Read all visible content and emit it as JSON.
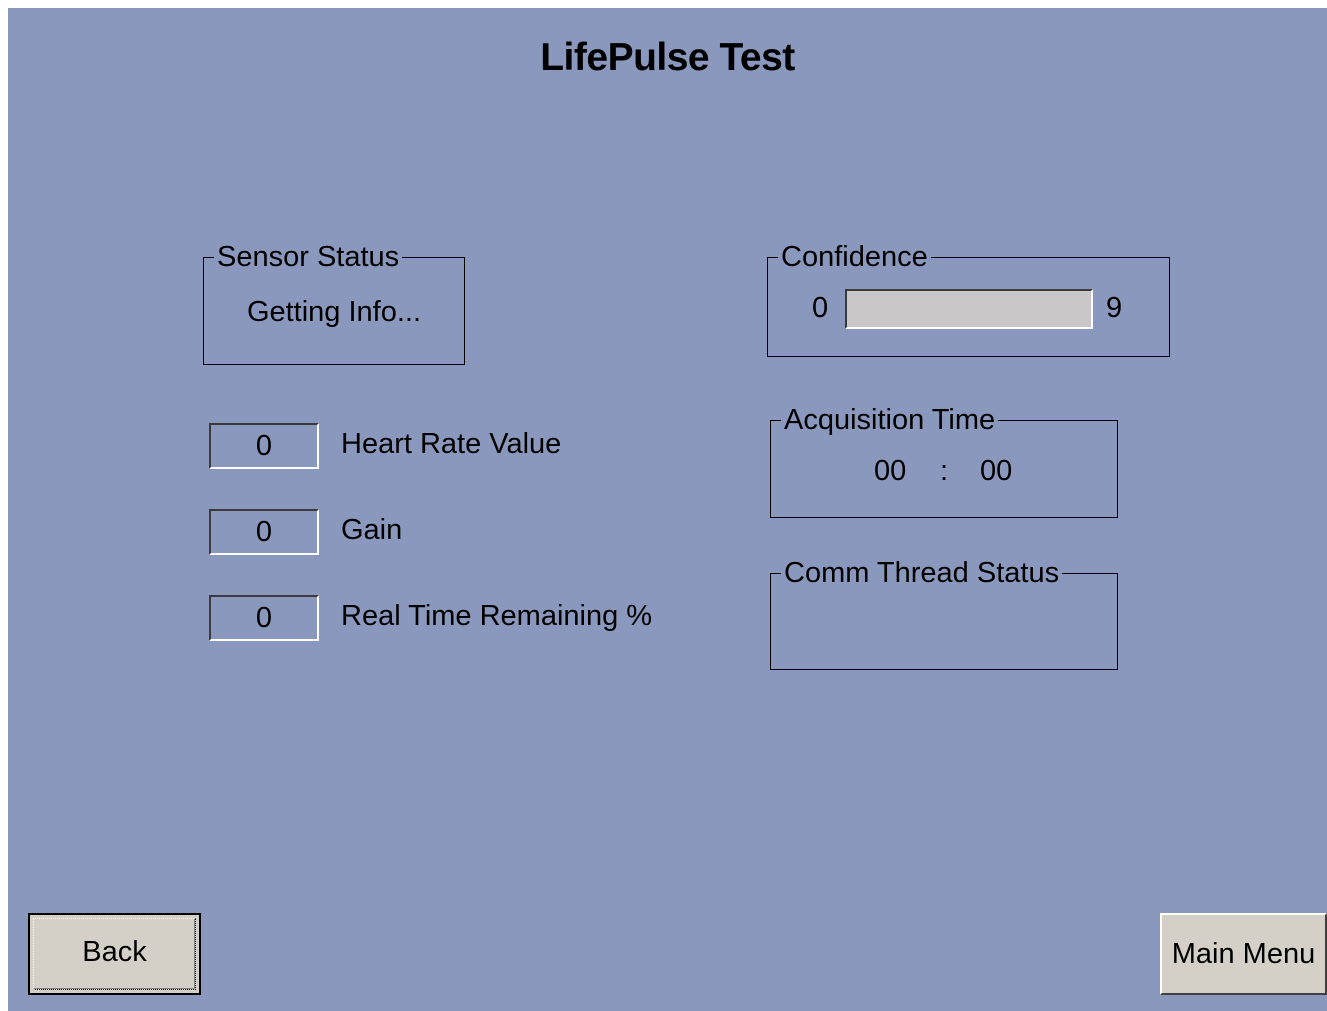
{
  "title": "LifePulse Test",
  "sensor_status": {
    "legend": "Sensor Status",
    "value": "Getting Info..."
  },
  "fields": {
    "heart_rate": {
      "value": "0",
      "label": "Heart Rate Value"
    },
    "gain": {
      "value": "0",
      "label": "Gain"
    },
    "real_time_remaining": {
      "value": "0",
      "label": "Real Time Remaining %"
    }
  },
  "confidence": {
    "legend": "Confidence",
    "min": "0",
    "max": "9",
    "level": 0
  },
  "acquisition_time": {
    "legend": "Acquisition Time",
    "minutes": "00",
    "separator": ":",
    "seconds": "00"
  },
  "comm_thread_status": {
    "legend": "Comm Thread Status",
    "value": ""
  },
  "buttons": {
    "back": "Back",
    "main_menu": "Main Menu"
  }
}
